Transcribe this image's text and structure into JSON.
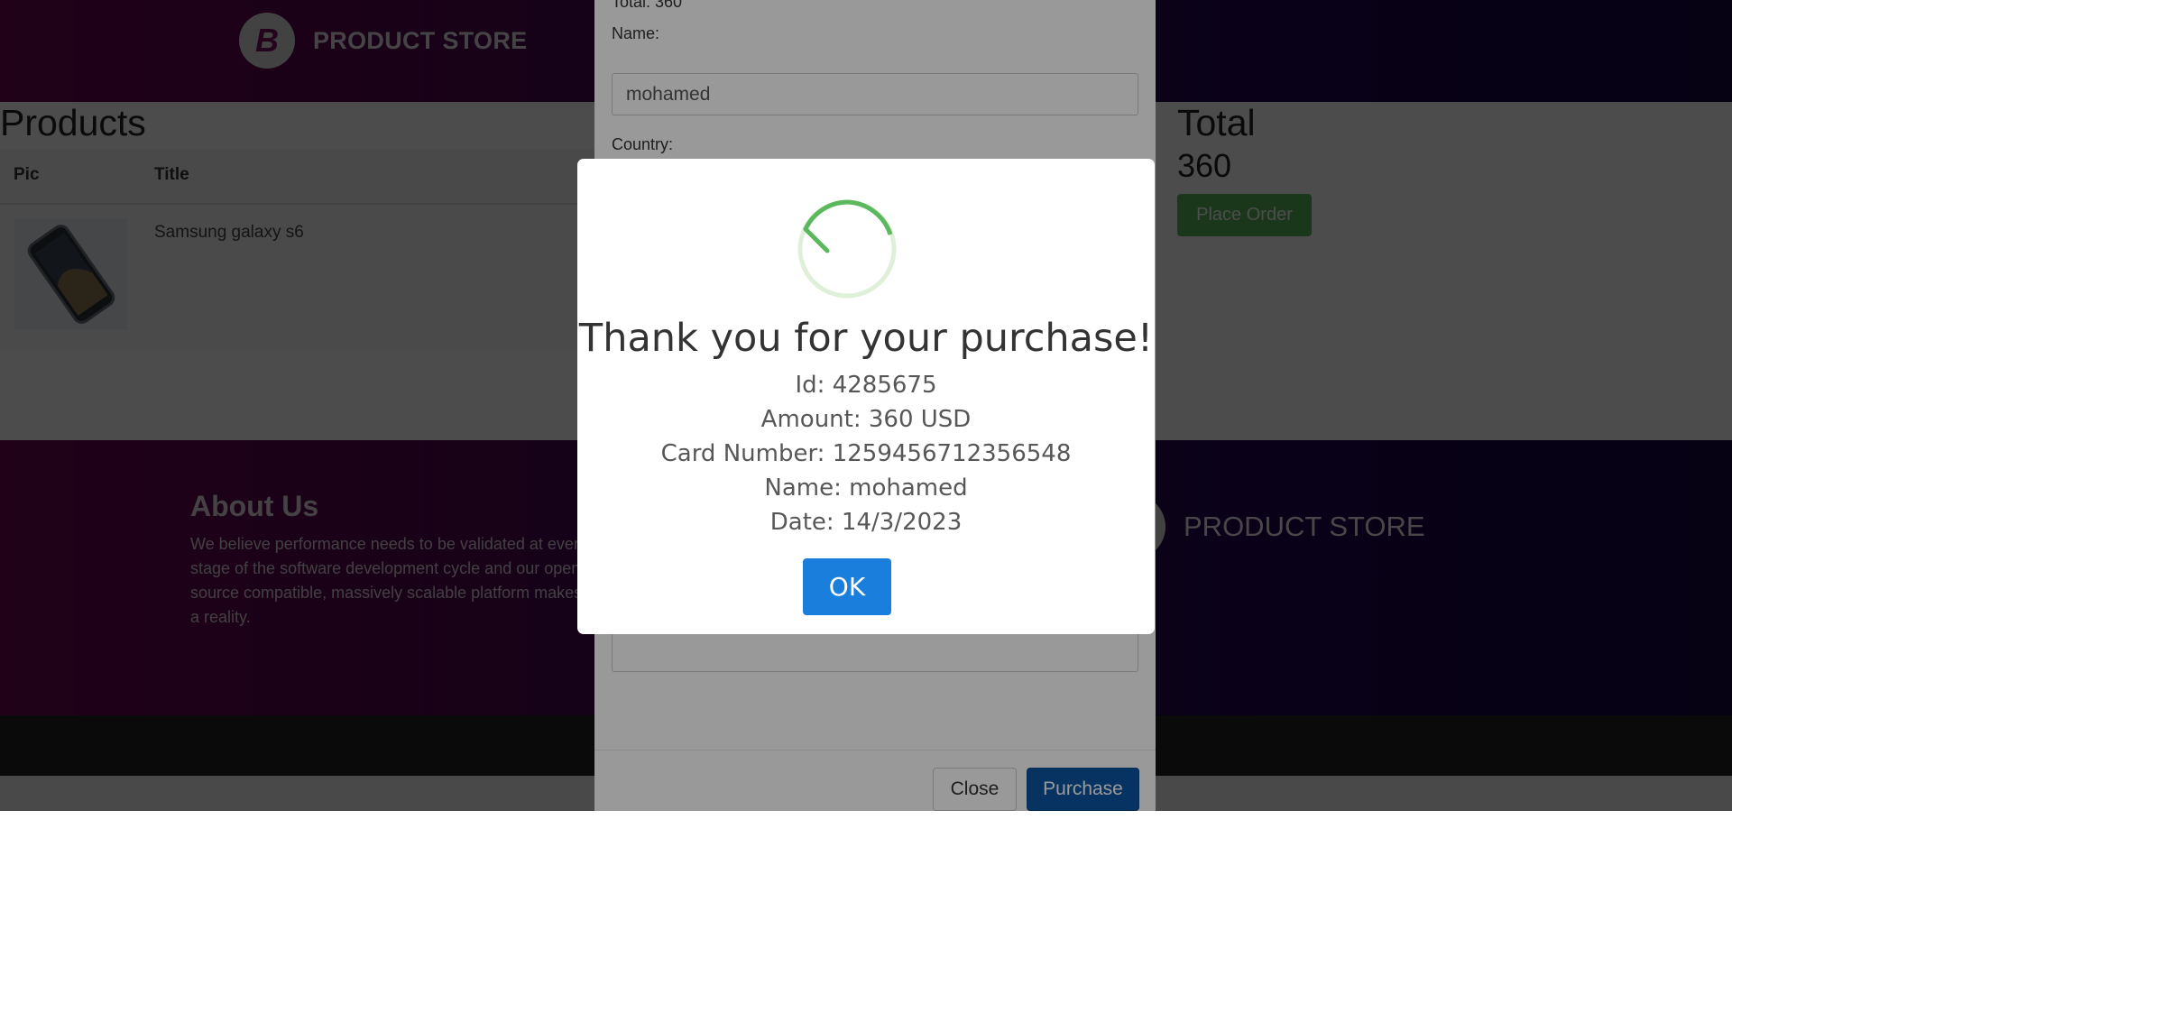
{
  "navbar": {
    "brand_text": "PRODUCT STORE",
    "brand_letter": "B"
  },
  "cart": {
    "title": "Products",
    "columns": [
      "Pic",
      "Title"
    ],
    "rows": [
      {
        "title": "Samsung galaxy s6"
      }
    ],
    "total_label": "Total",
    "total_value": "360",
    "place_order": "Place Order"
  },
  "footer": {
    "about_title": "About Us",
    "about_text": "We believe performance needs to be validated at every stage of the software development cycle and our open source compatible, massively scalable platform makes that a reality.",
    "brand_text": "PRODUCT STORE"
  },
  "order_modal": {
    "total": "Total: 360",
    "name_label": "Name:",
    "name_value": "mohamed",
    "country_label": "Country:",
    "close": "Close",
    "purchase": "Purchase"
  },
  "alert": {
    "title": "Thank you for your purchase!",
    "id": "Id: 4285675",
    "amount": "Amount: 360 USD",
    "card": "Card Number: 1259456712356548",
    "name": "Name: mohamed",
    "date": "Date: 14/3/2023",
    "ok": "OK",
    "icon": "success-check-icon",
    "accent": "#1a7fdc"
  }
}
